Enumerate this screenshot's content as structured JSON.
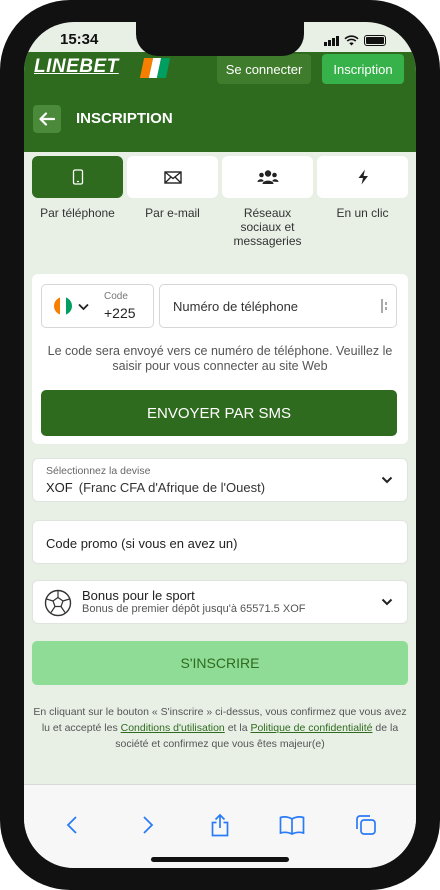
{
  "status_bar": {
    "time": "15:34"
  },
  "header": {
    "logo": "LINEBET",
    "login_label": "Se connecter",
    "register_label": "Inscription"
  },
  "title_bar": {
    "title": "INSCRIPTION"
  },
  "tabs": [
    {
      "label": "Par téléphone",
      "icon": "phone-icon",
      "active": true
    },
    {
      "label": "Par e-mail",
      "icon": "mail-icon",
      "active": false
    },
    {
      "label": "Réseaux sociaux et messageries",
      "icon": "users-icon",
      "active": false
    },
    {
      "label": "En un clic",
      "icon": "lightning-icon",
      "active": false
    }
  ],
  "phone_form": {
    "country_flag": "flag-ci-icon",
    "code_label": "Code",
    "code_value": "+225",
    "phone_placeholder": "Numéro de téléphone",
    "info_text": "Le code sera envoyé vers ce numéro de téléphone. Veuillez le saisir pour vous connecter au site Web",
    "send_sms_label": "ENVOYER PAR SMS"
  },
  "currency": {
    "label": "Sélectionnez la devise",
    "code": "XOF",
    "name": "(Franc CFA d'Afrique de l'Ouest)"
  },
  "promo": {
    "placeholder": "Code promo (si vous en avez un)"
  },
  "bonus": {
    "title": "Bonus pour le sport",
    "subtitle": "Bonus de premier dépôt jusqu'à 65571.5 XOF"
  },
  "submit_label": "S'INSCRIRE",
  "terms": {
    "part1": "En cliquant sur le bouton « S'inscrire » ci-dessus, vous confirmez que vous avez lu et accepté les ",
    "link1": "Conditions d'utilisation",
    "part2": " et la ",
    "link2": "Politique de confidentialité",
    "part3": " de la société et confirmez que vous êtes majeur(e)"
  },
  "colors": {
    "primary_green": "#2f6b1e",
    "register_green": "#37b24a",
    "submit_disabled": "#8fdc97",
    "background": "#e8f0e6"
  }
}
